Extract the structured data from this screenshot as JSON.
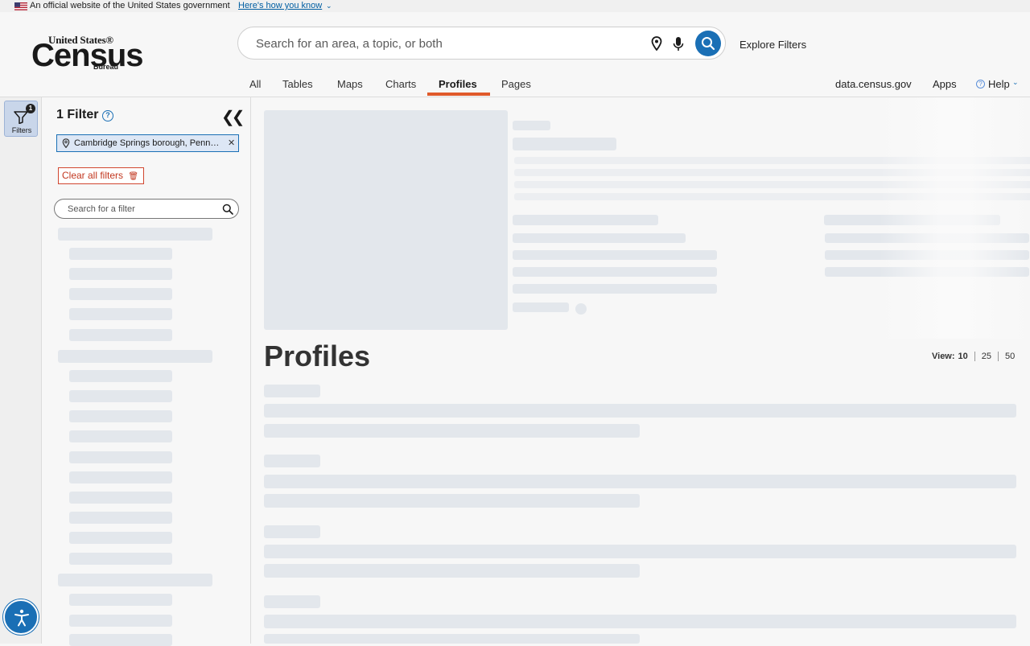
{
  "gov_banner": {
    "text": "An official website of the United States government",
    "link": "Here's how you know"
  },
  "logo": {
    "line1": "United States®",
    "line2": "Census",
    "line3": "Bureau"
  },
  "search": {
    "placeholder": "Search for an area, a topic, or both"
  },
  "explore_label": "Explore Filters",
  "nav": {
    "tabs": [
      {
        "label": "All"
      },
      {
        "label": "Tables"
      },
      {
        "label": "Maps"
      },
      {
        "label": "Charts"
      },
      {
        "label": "Profiles",
        "active": true
      },
      {
        "label": "Pages"
      }
    ],
    "util": {
      "data": "data.census.gov",
      "apps": "Apps",
      "help": "Help"
    }
  },
  "rail": {
    "filters_label": "Filters",
    "badge": "1"
  },
  "filter_panel": {
    "title": "1 Filter",
    "chip": "Cambridge Springs borough, Pennsylvania",
    "clear_all": "Clear all filters",
    "search_placeholder": "Search for a filter"
  },
  "main": {
    "title": "Profiles",
    "view_label": "View:",
    "view_options": [
      "10",
      "25",
      "50"
    ]
  },
  "colors": {
    "accent": "#1a6fb5",
    "active_tab_underline": "#e05a2b",
    "clear_button": "#c2371f",
    "skeleton": "#e3e7ec"
  }
}
